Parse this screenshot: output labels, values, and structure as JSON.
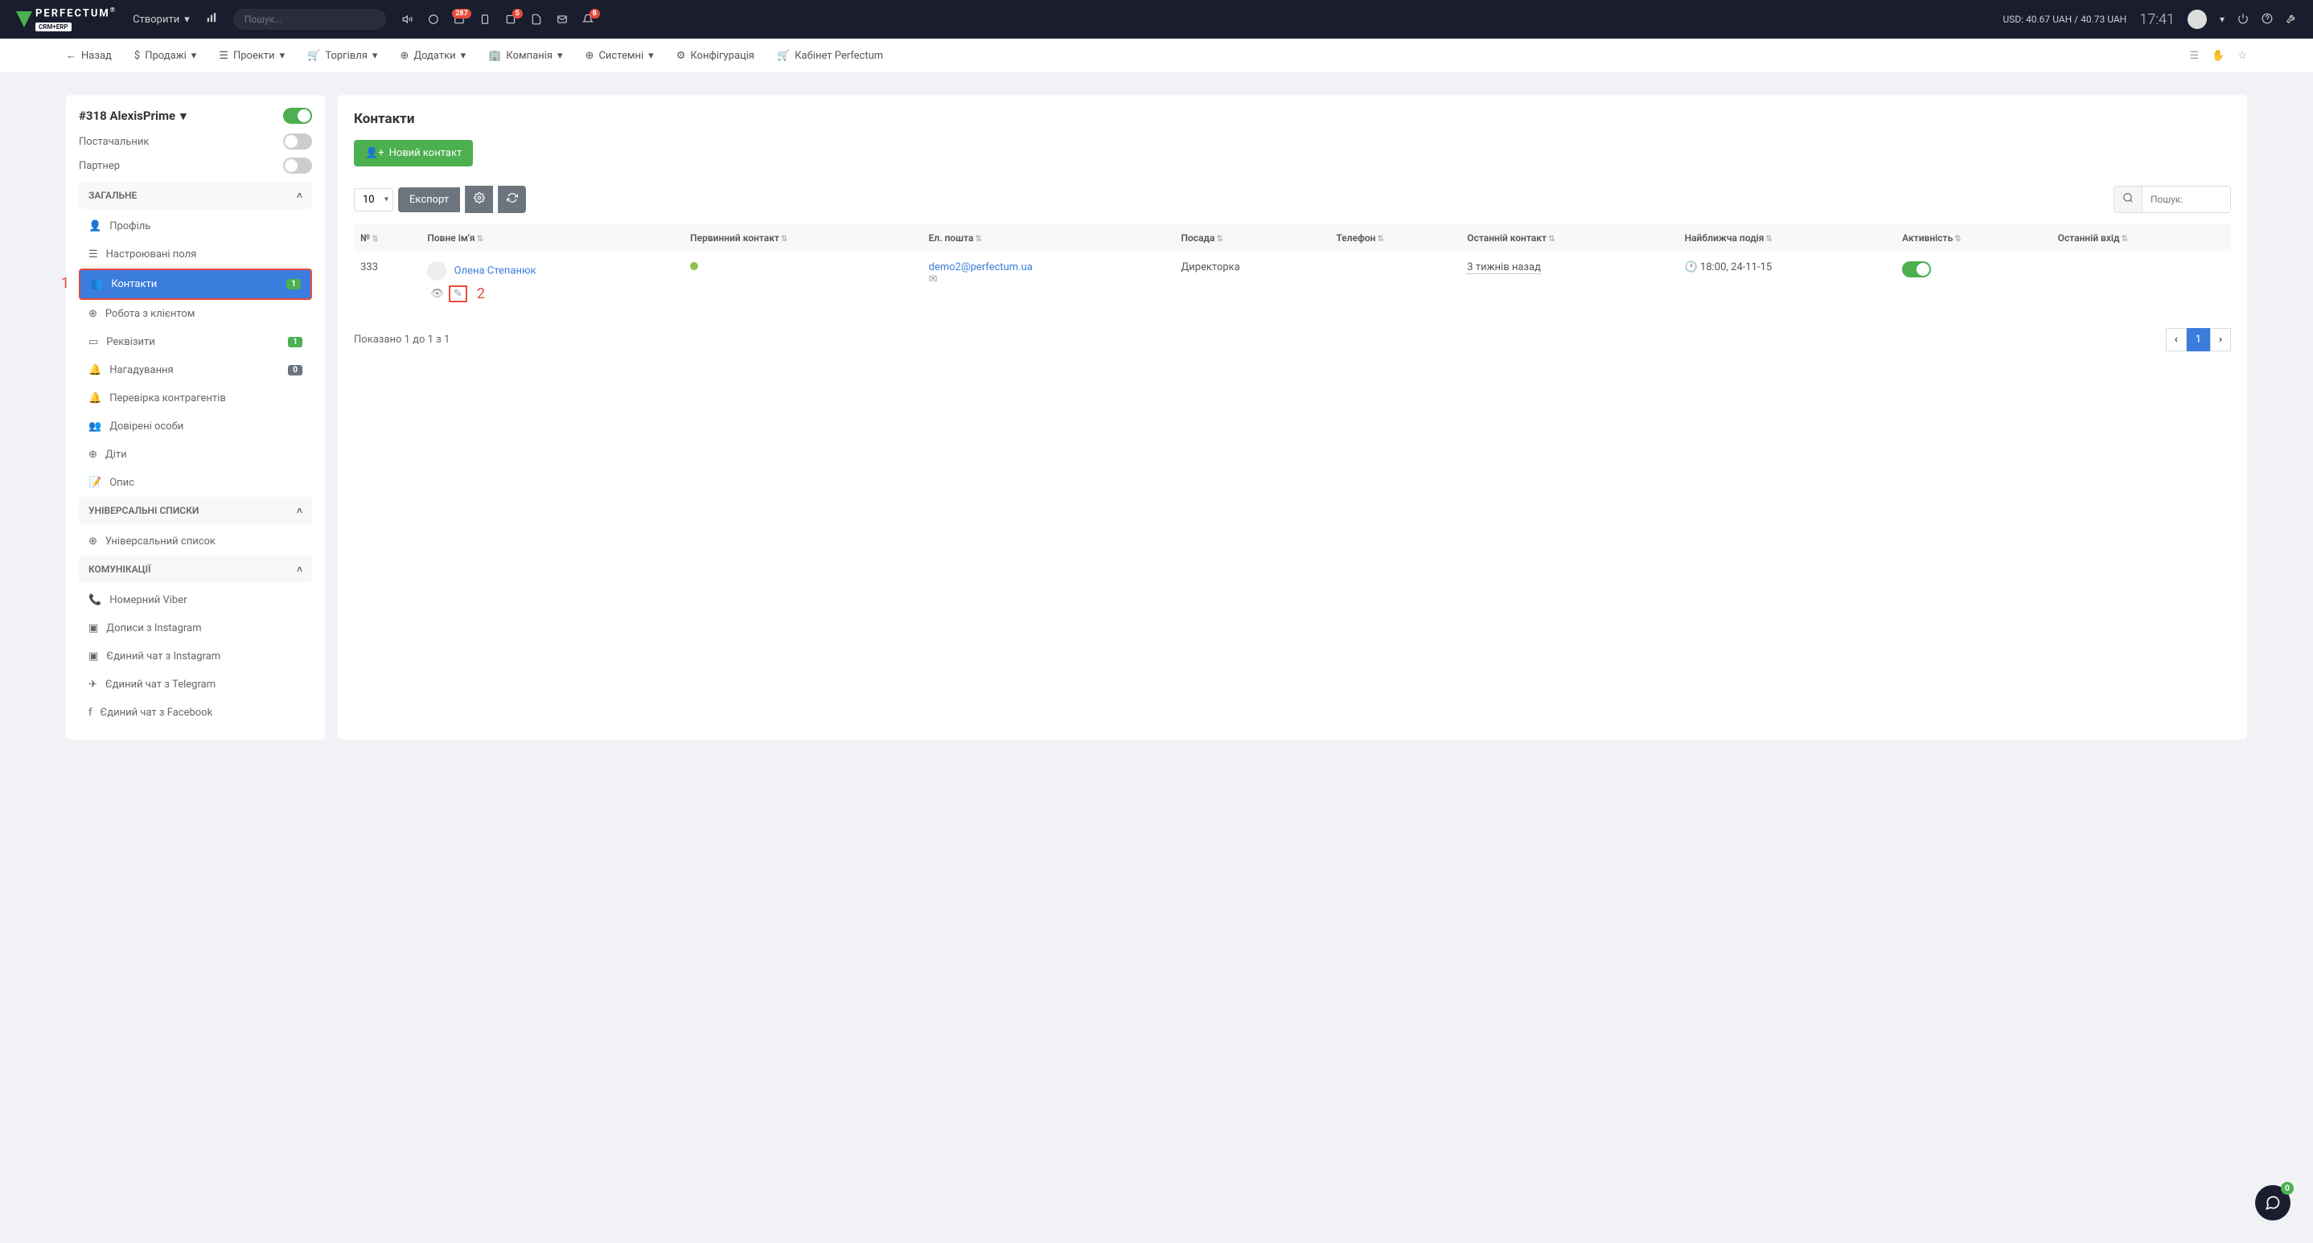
{
  "top": {
    "create": "Створити",
    "search_placeholder": "Пошук...",
    "badges": {
      "messages": "287",
      "tasks": "5",
      "notifications": "8"
    },
    "currency": "USD: 40.67 UAH / 40.73 UAH",
    "time": "17:41"
  },
  "menu": {
    "back": "Назад",
    "items": [
      "Продажі",
      "Проекти",
      "Торгівля",
      "Додатки",
      "Компанія",
      "Системні",
      "Конфігурація",
      "Кабінет Perfectum"
    ]
  },
  "sidebar": {
    "company": "#318 AlexisPrime",
    "supplier": "Постачальник",
    "partner": "Партнер",
    "section_general": "ЗАГАЛЬНЕ",
    "items_general": [
      {
        "label": "Профіль"
      },
      {
        "label": "Настроювані поля"
      },
      {
        "label": "Контакти",
        "badge": "1",
        "active": true
      },
      {
        "label": "Робота з клієнтом"
      },
      {
        "label": "Реквізити",
        "badge": "1"
      },
      {
        "label": "Нагадування",
        "badge": "0"
      },
      {
        "label": "Перевірка контрагентів"
      },
      {
        "label": "Довірені особи"
      },
      {
        "label": "Діти"
      },
      {
        "label": "Опис"
      }
    ],
    "section_universal": "УНІВЕРСАЛЬНІ СПИСКИ",
    "items_universal": [
      {
        "label": "Універсальний список"
      }
    ],
    "section_comm": "КОМУНІКАЦІЇ",
    "items_comm": [
      {
        "label": "Номерний Viber"
      },
      {
        "label": "Дописи з Instagram"
      },
      {
        "label": "Єдиний чат з Instagram"
      },
      {
        "label": "Єдиний чат з Telegram"
      },
      {
        "label": "Єдиний чат з Facebook"
      }
    ]
  },
  "main": {
    "title": "Контакти",
    "new_contact": "Новий контакт",
    "page_size": "10",
    "export": "Експорт",
    "search_label": "Пошук:",
    "columns": [
      "№",
      "Повне ім'я",
      "Первинний контакт",
      "Ел. пошта",
      "Посада",
      "Телефон",
      "Останній контакт",
      "Найближча подія",
      "Активність",
      "Останній вхід"
    ],
    "row": {
      "num": "333",
      "name": "Олена Степанюк",
      "email": "demo2@perfectum.ua",
      "position": "Директорка",
      "last_contact": "3 тижнів назад",
      "next_event": "18:00, 24-11-15"
    },
    "footer": "Показано 1 до 1 з 1",
    "page": "1"
  },
  "annotations": {
    "one": "1",
    "two": "2"
  },
  "chat_badge": "0"
}
